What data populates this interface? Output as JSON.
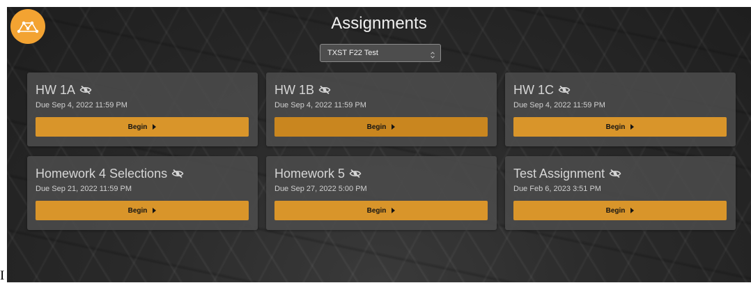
{
  "header": {
    "title": "Assignments",
    "course_select": {
      "selected": "TXST F22 Test"
    }
  },
  "colors": {
    "accent": "#d9952a",
    "logo": "#f3a332",
    "card_bg": "#4b4b4b"
  },
  "icons": {
    "logo": "network-logo-icon",
    "hidden": "eye-slash-icon",
    "begin_arrow": "caret-right-icon",
    "select_chevron": "chevron-updown-icon"
  },
  "assignments": [
    {
      "title": "HW 1A",
      "due": "Due Sep 4, 2022 11:59 PM",
      "button": "Begin"
    },
    {
      "title": "HW 1B",
      "due": "Due Sep 4, 2022 11:59 PM",
      "button": "Begin"
    },
    {
      "title": "HW 1C",
      "due": "Due Sep 4, 2022 11:59 PM",
      "button": "Begin"
    },
    {
      "title": "Homework 4 Selections",
      "due": "Due Sep 21, 2022 11:59 PM",
      "button": "Begin"
    },
    {
      "title": "Homework 5",
      "due": "Due Sep 27, 2022 5:00 PM",
      "button": "Begin"
    },
    {
      "title": "Test Assignment",
      "due": "Due Feb 6, 2023 3:51 PM",
      "button": "Begin"
    }
  ],
  "footer_text": "I"
}
